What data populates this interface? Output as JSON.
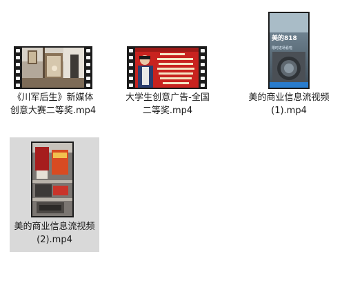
{
  "files": [
    {
      "name": "《川军后生》新媒体创意大赛二等奖.mp4",
      "thumbnail": "video-frame-interior-room",
      "selected": false
    },
    {
      "name": "大学生创意广告-全国二等奖.mp4",
      "thumbnail": "video-frame-red-poster",
      "selected": false
    },
    {
      "name": "美的商业信息流视频 (1).mp4",
      "thumbnail": "video-frame-washing-machine",
      "thumb_caption_top": "美的818",
      "thumb_caption_bottom": "限时进场看啦",
      "selected": false
    },
    {
      "name": "美的商业信息流视频 (2).mp4",
      "thumbnail": "video-frame-store-shelf",
      "selected": true
    }
  ],
  "colors": {
    "selection": "#d9d9d9",
    "film": "#1c1c1c",
    "poster_red": "#c8231f"
  }
}
